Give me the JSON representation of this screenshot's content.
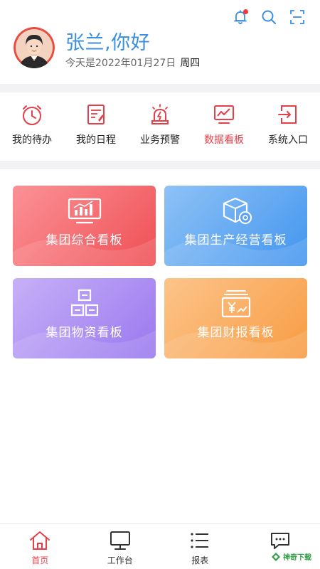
{
  "user": {
    "greeting": "张兰,你好",
    "date_text": "今天是2022年01月27日",
    "weekday": "周四"
  },
  "top_icons": [
    "bell-icon",
    "search-icon",
    "scan-icon"
  ],
  "quick_menu": [
    {
      "label": "我的待办",
      "icon": "clock-icon"
    },
    {
      "label": "我的日程",
      "icon": "schedule-icon"
    },
    {
      "label": "业务预警",
      "icon": "alarm-icon"
    },
    {
      "label": "数据看板",
      "icon": "chart-board-icon",
      "active": true
    },
    {
      "label": "系统入口",
      "icon": "exit-icon"
    }
  ],
  "cards": [
    {
      "label": "集团综合看板",
      "icon": "monitor-chart-icon"
    },
    {
      "label": "集团生产经营看板",
      "icon": "box-gear-icon"
    },
    {
      "label": "集团物资看板",
      "icon": "boxes-icon"
    },
    {
      "label": "集团财报看板",
      "icon": "money-report-icon"
    }
  ],
  "tabbar": [
    {
      "label": "首页",
      "icon": "home-icon",
      "active": true
    },
    {
      "label": "工作台",
      "icon": "desktop-icon"
    },
    {
      "label": "报表",
      "icon": "report-list-icon"
    },
    {
      "label": "",
      "icon": "message-icon"
    }
  ],
  "watermark": {
    "label": "神奇下载"
  },
  "colors": {
    "primary_blue": "#3a8fe0",
    "accent_red": "#e5404a",
    "separator": "#f2f2f4"
  }
}
